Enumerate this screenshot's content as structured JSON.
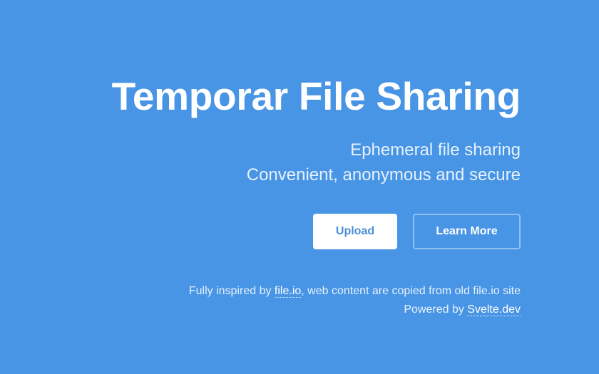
{
  "hero": {
    "title": "Temporar File Sharing",
    "subtitle_line1": "Ephemeral file sharing",
    "subtitle_line2": "Convenient, anonymous and secure"
  },
  "actions": {
    "upload_label": "Upload",
    "learn_more_label": "Learn More"
  },
  "footer": {
    "inspired_prefix": "Fully inspired by ",
    "inspired_link": "file.io",
    "inspired_suffix": ", web content are copied from old file.io site",
    "powered_prefix": "Powered by ",
    "powered_link": "Svelte.dev"
  },
  "colors": {
    "background": "#4895e6",
    "primary_button_text": "#4a8fd6",
    "text": "#ffffff"
  }
}
